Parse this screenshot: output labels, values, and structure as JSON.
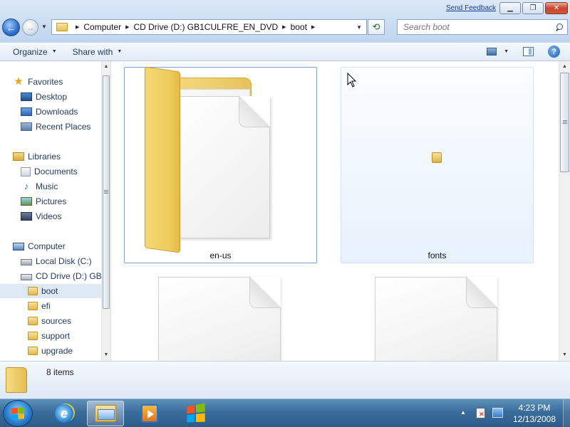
{
  "window": {
    "feedback_label": "Send Feedback",
    "minimize_glyph": "▁",
    "maximize_glyph": "❐",
    "close_glyph": "✕"
  },
  "address": {
    "crumbs": [
      "Computer",
      "CD Drive (D:) GB1CULFRE_EN_DVD",
      "boot"
    ],
    "search_placeholder": "Search boot"
  },
  "toolbar": {
    "organize": "Organize",
    "share_with": "Share with"
  },
  "navigation": {
    "favorites": "Favorites",
    "favorites_items": [
      "Desktop",
      "Downloads",
      "Recent Places"
    ],
    "libraries": "Libraries",
    "libraries_items": [
      "Documents",
      "Music",
      "Pictures",
      "Videos"
    ],
    "computer": "Computer",
    "computer_items": [
      "Local Disk (C:)",
      "CD Drive (D:) GB1CULFRE_EN_DVD"
    ],
    "folders": [
      "boot",
      "efi",
      "sources",
      "support",
      "upgrade"
    ],
    "selected_folder": "boot"
  },
  "content": {
    "items": [
      {
        "name": "en-us",
        "type": "folder",
        "state": "selected"
      },
      {
        "name": "fonts",
        "type": "folder",
        "state": "hover"
      },
      {
        "name": "",
        "type": "file"
      },
      {
        "name": "",
        "type": "file"
      }
    ]
  },
  "details": {
    "item_count": "8 items"
  },
  "taskbar": {
    "apps": [
      "internet-explorer",
      "windows-explorer",
      "media-player",
      "windows"
    ],
    "time": "4:23 PM",
    "date": "12/13/2008"
  },
  "colors": {
    "selection_border": "#7da2ce",
    "taskbar": "#3a6d9c",
    "folder_yellow": "#efcb5d"
  }
}
